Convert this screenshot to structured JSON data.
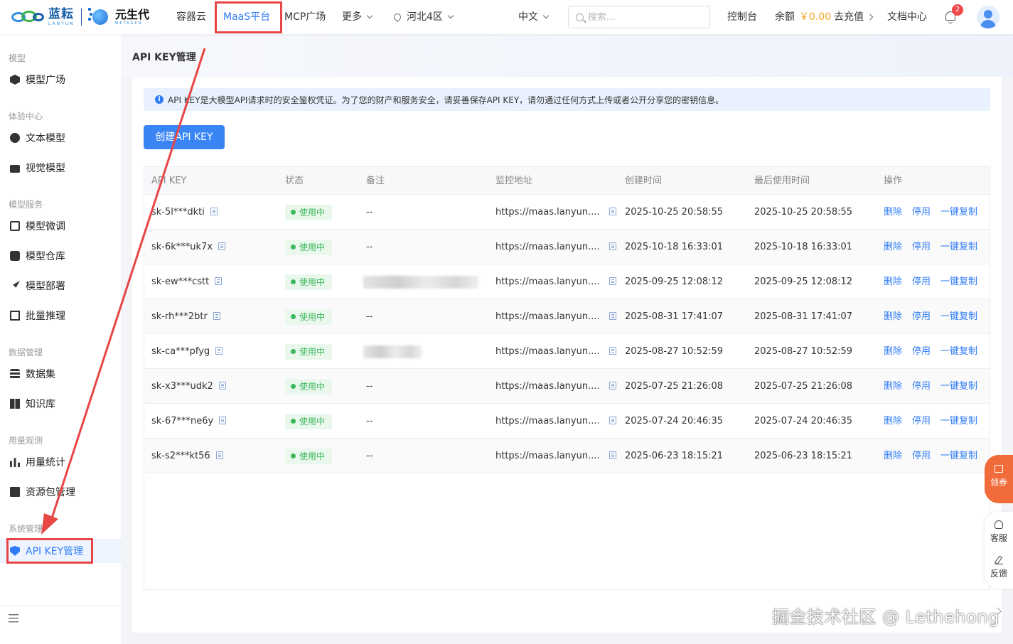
{
  "brand": {
    "logo1_cn": "蓝耘",
    "logo1_en": "LANYUN",
    "logo2_cn": "元生代",
    "logo2_en": "METAGEN"
  },
  "topnav": {
    "items": [
      "容器云",
      "MaaS平台",
      "MCP广场",
      "更多"
    ],
    "region": "河北4区",
    "language": "中文",
    "search_placeholder": "搜索...",
    "console": "控制台",
    "balance_label": "余额",
    "balance_amount": "￥0.00",
    "recharge": "去充值",
    "docs": "文档中心",
    "notification_count": "2"
  },
  "sidebar": {
    "groups": [
      {
        "title": "模型",
        "items": [
          {
            "label": "模型广场",
            "icon": "cube-icon"
          }
        ]
      },
      {
        "title": "体验中心",
        "items": [
          {
            "label": "文本模型",
            "icon": "chat-icon"
          },
          {
            "label": "视觉模型",
            "icon": "camera-icon"
          }
        ]
      },
      {
        "title": "模型服务",
        "items": [
          {
            "label": "模型微调",
            "icon": "tune-icon"
          },
          {
            "label": "模型仓库",
            "icon": "box-icon"
          },
          {
            "label": "模型部署",
            "icon": "rocket-icon"
          },
          {
            "label": "批量推理",
            "icon": "doc-icon"
          }
        ]
      },
      {
        "title": "数据管理",
        "items": [
          {
            "label": "数据集",
            "icon": "database-icon"
          },
          {
            "label": "知识库",
            "icon": "book-icon"
          }
        ]
      },
      {
        "title": "用量观测",
        "items": [
          {
            "label": "用量统计",
            "icon": "bar-chart-icon"
          },
          {
            "label": "资源包管理",
            "icon": "gift-icon"
          }
        ]
      },
      {
        "title": "系统管理",
        "items": [
          {
            "label": "API KEY管理",
            "icon": "shield-icon"
          }
        ]
      }
    ]
  },
  "page": {
    "title": "API KEY管理",
    "notice": "API KEY是大模型API请求时的安全鉴权凭证。为了您的财产和服务安全，请妥善保存API KEY，请勿通过任何方式上传或者公开分享您的密钥信息。",
    "create_button": "创建API KEY"
  },
  "table": {
    "columns": [
      "API KEY",
      "状态",
      "备注",
      "监控地址",
      "创建时间",
      "最后使用时间",
      "操作"
    ],
    "actions": [
      "删除",
      "停用",
      "一键复制"
    ],
    "rows": [
      {
        "key": "sk-5l***dkti",
        "status": "使用中",
        "note": "--",
        "url": "https://maas.lanyun....",
        "created": "2025-10-25 20:58:55",
        "last_used": "2025-10-25 20:58:55"
      },
      {
        "key": "sk-6k***uk7x",
        "status": "使用中",
        "note": "--",
        "url": "https://maas.lanyun....",
        "created": "2025-10-18 16:33:01",
        "last_used": "2025-10-18 16:33:01"
      },
      {
        "key": "sk-ew***cstt",
        "status": "使用中",
        "note": "",
        "url": "https://maas.lanyun....",
        "created": "2025-09-25 12:08:12",
        "last_used": "2025-09-25 12:08:12"
      },
      {
        "key": "sk-rh***2btr",
        "status": "使用中",
        "note": "--",
        "url": "https://maas.lanyun....",
        "created": "2025-08-31 17:41:07",
        "last_used": "2025-08-31 17:41:07"
      },
      {
        "key": "sk-ca***pfyg",
        "status": "使用中",
        "note": "",
        "url": "https://maas.lanyun....",
        "created": "2025-08-27 10:52:59",
        "last_used": "2025-08-27 10:52:59"
      },
      {
        "key": "sk-x3***udk2",
        "status": "使用中",
        "note": "--",
        "url": "https://maas.lanyun....",
        "created": "2025-07-25 21:26:08",
        "last_used": "2025-07-25 21:26:08"
      },
      {
        "key": "sk-67***ne6y",
        "status": "使用中",
        "note": "--",
        "url": "https://maas.lanyun....",
        "created": "2025-07-24 20:46:35",
        "last_used": "2025-07-24 20:46:35"
      },
      {
        "key": "sk-s2***kt56",
        "status": "使用中",
        "note": "--",
        "url": "https://maas.lanyun....",
        "created": "2025-06-23 18:15:21",
        "last_used": "2025-06-23 18:15:21"
      }
    ]
  },
  "floating": {
    "coupon": "领券",
    "support": "客服",
    "feedback": "反馈"
  },
  "watermark": "掘金技术社区 @ Lethehong",
  "colors": {
    "accent": "#2f7cf6",
    "status_green": "#3bb85b",
    "annotation_red": "#e84545",
    "coupon_orange": "#f26b3a"
  }
}
